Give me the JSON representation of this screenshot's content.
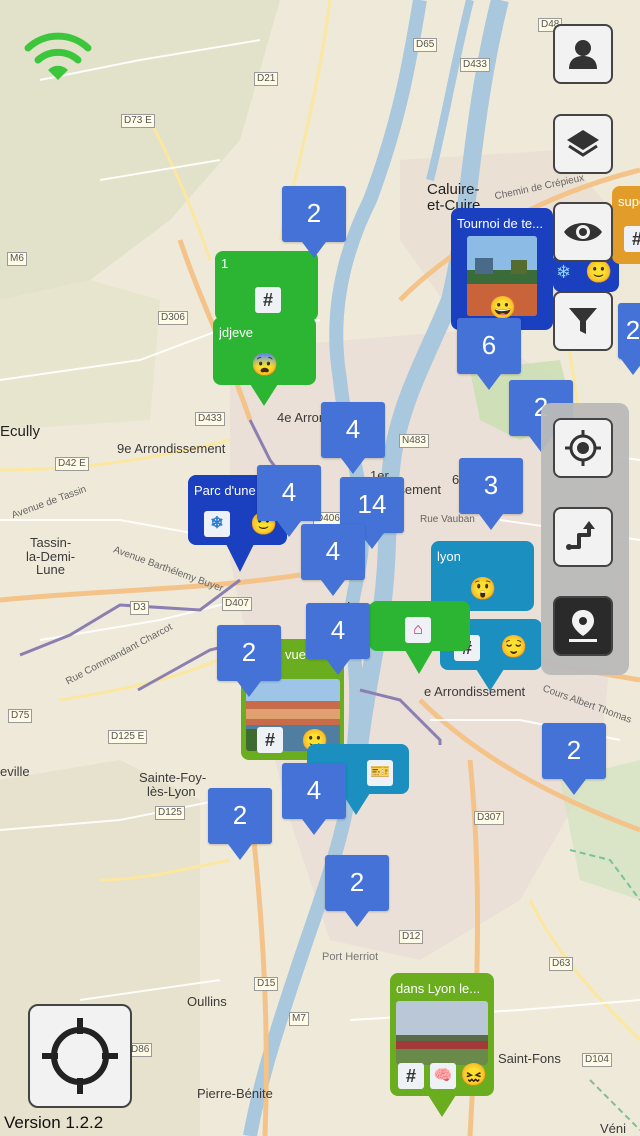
{
  "app": {
    "version_label": "Version 1.2.2"
  },
  "status": {
    "wifi_icon": "wifi-icon",
    "wifi_color": "#3cc63c"
  },
  "map": {
    "labels": {
      "caluire": "Caluire-",
      "caluire2": "et-Cuire",
      "ecully": "Ecully",
      "arr9": "9e Arrondissement",
      "arr4": "4e Arrond",
      "arr1": "1er",
      "arr1b": "Arrondissement",
      "arr6": "6",
      "arr7": "e Arrondissement",
      "tassin": "Tassin-",
      "tassin2": "la-Demi-",
      "tassin3": "Lune",
      "sainte_foy": "Sainte-Foy-",
      "sainte_foy2": "lès-Lyon",
      "oullins": "Oullins",
      "pierre_benite": "Pierre-Bénite",
      "saint_fons": "Saint-Fons",
      "port_herriot": "Port Herriot",
      "eville": "eville",
      "lyon": "Lyon",
      "venis": "Véni",
      "chemin": "Chemin de Crépieux",
      "av_barthelemy": "Avenue Barthélemy Buyer",
      "rue_cdt": "Rue Commandant Charcot",
      "cours_albert": "Cours Albert Thomas",
      "rue_vaubant": "Rue Vauban",
      "av_gassin": "Avenue de Tassin"
    },
    "roads": [
      "D48",
      "D65",
      "D433",
      "D21",
      "D73 E",
      "M6",
      "D306",
      "D433",
      "N483",
      "D42 E",
      "D406",
      "D407",
      "D3",
      "D75",
      "D125 E",
      "D125",
      "D307",
      "D12",
      "D15",
      "M7",
      "D86",
      "D63",
      "D104",
      "D5"
    ],
    "clusters": [
      {
        "count": "2"
      },
      {
        "count": "6"
      },
      {
        "count": "2"
      },
      {
        "count": "4"
      },
      {
        "count": "4"
      },
      {
        "count": "14"
      },
      {
        "count": "3"
      },
      {
        "count": "4"
      },
      {
        "count": "4"
      },
      {
        "count": "2"
      },
      {
        "count": "4"
      },
      {
        "count": "2"
      },
      {
        "count": "2"
      },
      {
        "count": "2"
      },
      {
        "count": "2"
      }
    ],
    "cards": {
      "one": {
        "title": "1",
        "hash": "#"
      },
      "jdjeve": {
        "title": "jdjeve",
        "emoji": "😨"
      },
      "tournoi": {
        "title": "Tournoi de te...",
        "emoji": "😀",
        "emoji2": "🙂",
        "snow": "❄"
      },
      "super": {
        "title": "supe",
        "hash": "#"
      },
      "parc": {
        "title": "Parc d'une",
        "snow": "❄",
        "emoji": "🙂"
      },
      "lyon": {
        "title": "lyon",
        "emoji": "😲"
      },
      "home": {
        "icon": "⌂"
      },
      "hashcard": {
        "hash": "#",
        "emoji": "😌"
      },
      "vue": {
        "title": "vue",
        "hash": "#",
        "emoji": "🙂"
      },
      "ticket": {
        "icon": "🎫"
      },
      "dans_lyon": {
        "title": "dans Lyon le...",
        "hash": "#",
        "emoji": "🧠",
        "emoji2": "😖"
      }
    }
  },
  "controls": {
    "profile_icon": "user-icon",
    "layers_icon": "layers-icon",
    "eye_icon": "eye-icon",
    "filter_icon": "filter-icon",
    "gps_icon": "crosshair-icon",
    "route_icon": "route-icon",
    "marker_icon": "map-marker-icon",
    "locate_icon": "locate-icon"
  },
  "colors": {
    "cluster": "#4472d6",
    "green": "#2cb533",
    "blue": "#1a3fbf",
    "teal": "#1b8fc0",
    "lightgreen": "#6aad1e",
    "orange": "#e29c2a"
  }
}
